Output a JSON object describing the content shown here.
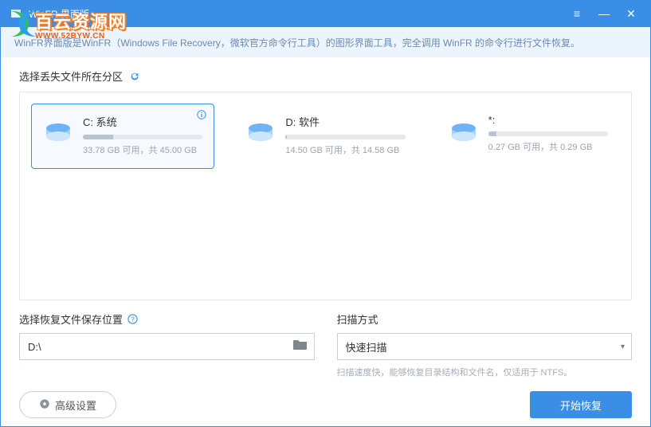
{
  "watermark": {
    "cn": "百云资源网",
    "url": "WWW.52BYW.CN"
  },
  "titlebar": {
    "title": "WinFR 界面版"
  },
  "banner": {
    "text": "WinFR界面版是WinFR（Windows File Recovery，微软官方命令行工具）的图形界面工具，完全调用 WinFR 的命令行进行文件恢复。"
  },
  "section_drive_label": "选择丢失文件所在分区",
  "drives": [
    {
      "name": "C: 系统",
      "free": "33.78 GB",
      "total": "45.00 GB",
      "used_pct": 25,
      "selected": true,
      "info": true
    },
    {
      "name": "D: 软件",
      "free": "14.50 GB",
      "total": "14.58 GB",
      "used_pct": 1,
      "selected": false,
      "info": false
    },
    {
      "name": "*:",
      "free": "0.27 GB",
      "total": "0.29 GB",
      "used_pct": 7,
      "selected": false,
      "info": false
    }
  ],
  "drive_stat_template": {
    "free_label": "可用",
    "sep": "，共"
  },
  "save_section": {
    "label": "选择恢复文件保存位置",
    "value": "D:\\"
  },
  "scan_section": {
    "label": "扫描方式",
    "value": "快速扫描",
    "hint": "扫描速度快，能够恢复目录结构和文件名，仅适用于 NTFS。"
  },
  "footer": {
    "advanced": "高级设置",
    "start": "开始恢复"
  }
}
